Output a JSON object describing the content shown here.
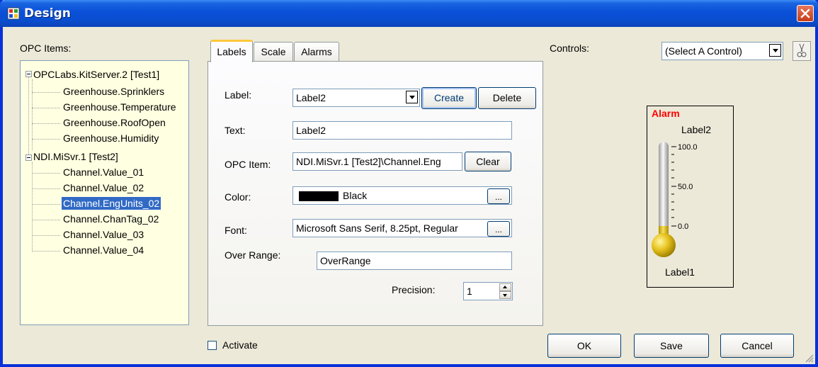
{
  "window": {
    "title": "Design",
    "close_icon": "close-icon"
  },
  "opc_items": {
    "label": "OPC Items:",
    "tree": [
      {
        "label": "OPCLabs.KitServer.2 [Test1]",
        "children": [
          "Greenhouse.Sprinklers",
          "Greenhouse.Temperature",
          "Greenhouse.RoofOpen",
          "Greenhouse.Humidity"
        ]
      },
      {
        "label": "NDI.MiSvr.1 [Test2]",
        "children": [
          "Channel.Value_01",
          "Channel.Value_02",
          "Channel.EngUnits_02",
          "Channel.ChanTag_02",
          "Channel.Value_03",
          "Channel.Value_04"
        ]
      }
    ],
    "selected": "Channel.EngUnits_02"
  },
  "tabs": [
    "Labels",
    "Scale",
    "Alarms"
  ],
  "active_tab": "Labels",
  "labels_tab": {
    "label_caption": "Label:",
    "label_value": "Label2",
    "create_label": "Create",
    "delete_label": "Delete",
    "text_caption": "Text:",
    "text_value": "Label2",
    "opc_item_caption": "OPC Item:",
    "opc_item_value": "NDI.MiSvr.1 [Test2]\\Channel.Eng",
    "clear_label": "Clear",
    "color_caption": "Color:",
    "color_value": "Black",
    "color_swatch": "#000000",
    "font_caption": "Font:",
    "font_value": "Microsoft Sans Serif, 8.25pt, Regular",
    "ellipsis": "...",
    "over_range_caption": "Over Range:",
    "over_range_value": "OverRange",
    "precision_caption": "Precision:",
    "precision_value": "1"
  },
  "controls": {
    "label": "Controls:",
    "select_value": "(Select A Control)",
    "cut_icon": "scissors-icon"
  },
  "preview": {
    "alarm_text": "Alarm",
    "alarm_color": "#ff0000",
    "top_label": "Label2",
    "bottom_label": "Label1",
    "ticks": [
      "100.0",
      "50.0",
      "0.0"
    ],
    "fill_level": 0
  },
  "footer": {
    "activate_label": "Activate",
    "activate_checked": false,
    "ok_label": "OK",
    "save_label": "Save",
    "cancel_label": "Cancel"
  }
}
